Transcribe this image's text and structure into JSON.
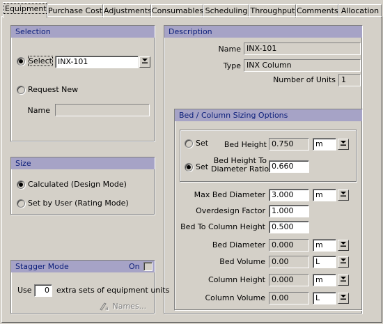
{
  "tabs": [
    "Equipment",
    "Purchase Cost",
    "Adjustments",
    "Consumables",
    "Scheduling",
    "Throughput",
    "Comments",
    "Allocation"
  ],
  "selection": {
    "header": "Selection",
    "select_label": "Select",
    "select_value": "INX-101",
    "request_new_label": "Request New",
    "name_label": "Name",
    "name_value": ""
  },
  "description": {
    "header": "Description",
    "name_label": "Name",
    "name_value": "INX-101",
    "type_label": "Type",
    "type_value": "INX Column",
    "units_label": "Number of Units",
    "units_value": "1"
  },
  "size": {
    "header": "Size",
    "calculated_label": "Calculated (Design Mode)",
    "set_by_user_label": "Set by User (Rating Mode)"
  },
  "stagger": {
    "header": "Stagger Mode",
    "on_label": "On",
    "use_label": "Use",
    "use_value": "0",
    "extra_label": "extra sets of equipment units",
    "names_label": "Names..."
  },
  "bed": {
    "header": "Bed / Column Sizing Options",
    "set_label": "Set",
    "bed_height_label": "Bed Height",
    "bed_height_value": "0.750",
    "bed_height_unit": "m",
    "ratio_label_1": "Bed Height To",
    "ratio_label_2": "Diameter Ratio",
    "ratio_value": "0.660",
    "max_diam_label": "Max Bed Diameter",
    "max_diam_value": "3.000",
    "max_diam_unit": "m",
    "overdesign_label": "Overdesign Factor",
    "overdesign_value": "1.000",
    "bed_to_col_label": "Bed To Column Height",
    "bed_to_col_value": "0.500",
    "bed_diam_label": "Bed Diameter",
    "bed_diam_value": "0.000",
    "bed_diam_unit": "m",
    "bed_vol_label": "Bed Volume",
    "bed_vol_value": "0.00",
    "bed_vol_unit": "L",
    "col_height_label": "Column Height",
    "col_height_value": "0.000",
    "col_height_unit": "m",
    "col_vol_label": "Column Volume",
    "col_vol_value": "0.00",
    "col_vol_unit": "L"
  },
  "colors": {
    "group_header_bg": "#a6a3c6",
    "group_header_text": "#0b1e7a",
    "window_bg": "#d4d0c8"
  },
  "icons": {
    "dropdown": "down-arrow-bar-icon",
    "names": "pen-label-icon"
  }
}
